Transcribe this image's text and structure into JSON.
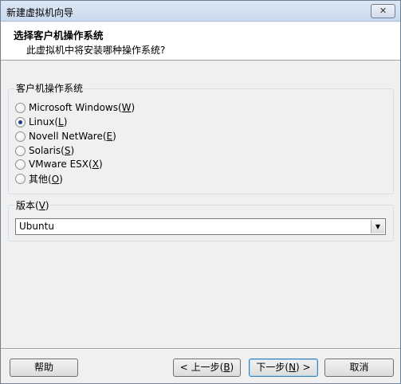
{
  "window": {
    "title": "新建虚拟机向导",
    "close_glyph": "✕"
  },
  "header": {
    "title": "选择客户机操作系统",
    "subtitle": "此虚拟机中将安装哪种操作系统?"
  },
  "guest_os": {
    "group_label": "客户机操作系统",
    "selected": "Linux",
    "options": [
      {
        "pre": "Microsoft Windows(",
        "key": "W",
        "post": ")",
        "checked": false
      },
      {
        "pre": "Linux(",
        "key": "L",
        "post": ")",
        "checked": true
      },
      {
        "pre": "Novell NetWare(",
        "key": "E",
        "post": ")",
        "checked": false
      },
      {
        "pre": "Solaris(",
        "key": "S",
        "post": ")",
        "checked": false
      },
      {
        "pre": "VMware ESX(",
        "key": "X",
        "post": ")",
        "checked": false
      },
      {
        "pre": "其他(",
        "key": "O",
        "post": ")",
        "checked": false
      }
    ]
  },
  "version": {
    "label_pre": "版本(",
    "label_key": "V",
    "label_post": ")",
    "selected": "Ubuntu"
  },
  "footer": {
    "help": "帮助",
    "back": {
      "pre": "< 上一步(",
      "key": "B",
      "post": ")"
    },
    "next": {
      "pre": "下一步(",
      "key": "N",
      "post": ") >"
    },
    "cancel": "取消"
  }
}
